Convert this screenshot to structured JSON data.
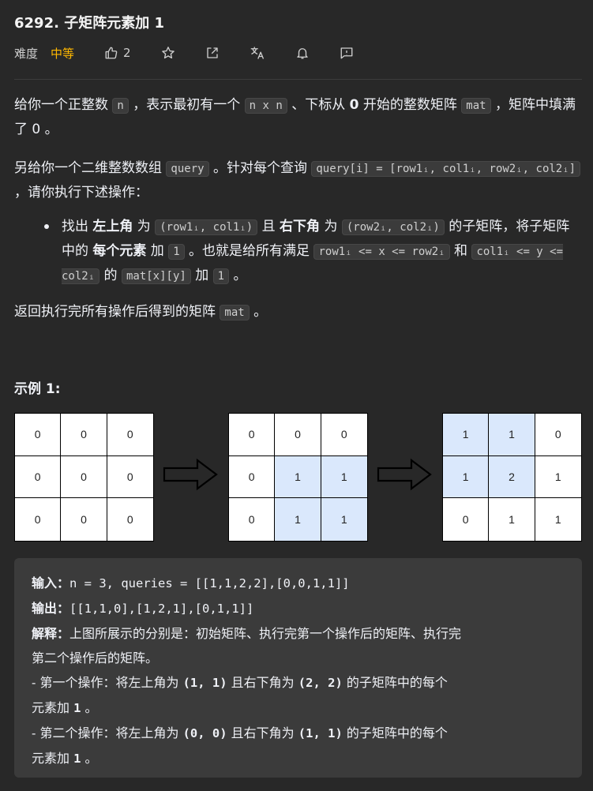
{
  "header": {
    "title": "6292. 子矩阵元素加 1",
    "difficulty_label": "难度",
    "difficulty": "中等",
    "like_count": "2",
    "icons": [
      "thumbs-up-icon",
      "star-icon",
      "share-icon",
      "translate-icon",
      "bell-icon",
      "feedback-icon"
    ]
  },
  "colors": {
    "accent": "#ffb800",
    "background": "#282828",
    "highlight_cell": "#dae8fc"
  },
  "desc": {
    "p1": {
      "t1": "给你一个正整数 ",
      "c1": "n",
      "t2": " ，表示最初有一个 ",
      "c2": "n x n",
      "t3": " 、下标从 ",
      "b1": "0",
      "t4": " 开始的整数矩阵 ",
      "c3": "mat",
      "t5": " ，矩阵中填满了 0 。"
    },
    "p2": {
      "t1": "另给你一个二维整数数组 ",
      "c1": "query",
      "t2": " 。针对每个查询 ",
      "c2": "query[i] = [row1ᵢ, col1ᵢ, row2ᵢ, col2ᵢ]",
      "t3": " ，请你执行下述操作："
    },
    "bullet": {
      "t1": "找出 ",
      "b1": "左上角",
      "t2": " 为 ",
      "c1": "(row1ᵢ, col1ᵢ)",
      "t3": " 且 ",
      "b2": "右下角",
      "t4": " 为 ",
      "c2": "(row2ᵢ, col2ᵢ)",
      "t5": " 的子矩阵，将子矩阵中的 ",
      "b3": "每个元素",
      "t6": " 加 ",
      "c3": "1",
      "t7": " 。也就是给所有满足 ",
      "c4": "row1ᵢ <= x <= row2ᵢ",
      "t8": " 和 ",
      "c5": "col1ᵢ <= y <= col2ᵢ",
      "t9": " 的 ",
      "c6": "mat[x][y]",
      "t10": " 加 ",
      "c7": "1",
      "t11": " 。"
    },
    "p3": {
      "t1": "返回执行完所有操作后得到的矩阵 ",
      "c1": "mat",
      "t2": " 。"
    }
  },
  "example": {
    "title": "示例 1:",
    "grids": [
      {
        "values": [
          "0",
          "0",
          "0",
          "0",
          "0",
          "0",
          "0",
          "0",
          "0"
        ],
        "highlight": []
      },
      {
        "values": [
          "0",
          "0",
          "0",
          "0",
          "1",
          "1",
          "0",
          "1",
          "1"
        ],
        "highlight": [
          4,
          5,
          7,
          8
        ]
      },
      {
        "values": [
          "1",
          "1",
          "0",
          "1",
          "2",
          "1",
          "0",
          "1",
          "1"
        ],
        "highlight": [
          0,
          1,
          3,
          4
        ]
      }
    ],
    "code": {
      "input_label": "输入：",
      "input": "n = 3, queries = [[1,1,2,2],[0,0,1,1]]",
      "output_label": "输出：",
      "output": "[[1,1,0],[1,2,1],[0,1,1]]",
      "explain_label": "解释：",
      "explain_1": "上图所展示的分别是：初始矩阵、执行完第一个操作后的矩阵、执行完",
      "explain_2": "第二个操作后的矩阵。",
      "op1_a": "- 第一个操作：将左上角为 ",
      "op1_b": "(1, 1)",
      "op1_c": " 且右下角为 ",
      "op1_d": "(2, 2)",
      "op1_e": " 的子矩阵中的每个",
      "op1_f": "元素加 ",
      "op1_g": "1",
      "op1_h": " 。",
      "op2_a": "- 第二个操作：将左上角为 ",
      "op2_b": "(0, 0)",
      "op2_c": " 且右下角为 ",
      "op2_d": "(1, 1)",
      "op2_e": " 的子矩阵中的每个",
      "op2_f": "元素加 ",
      "op2_g": "1",
      "op2_h": " 。"
    }
  }
}
